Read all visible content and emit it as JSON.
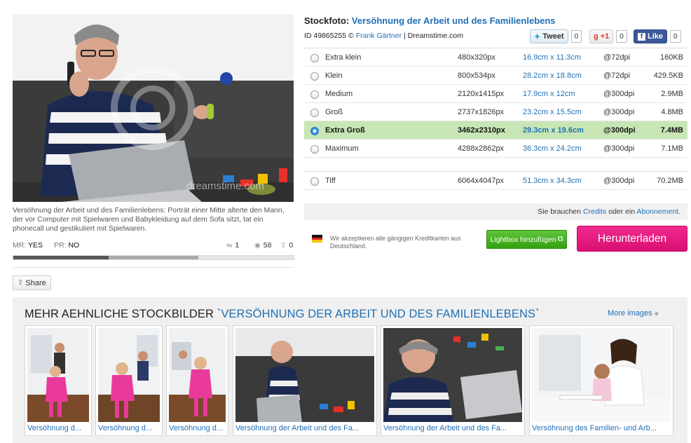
{
  "main_image": {
    "watermark": "dreamstime.com",
    "description": "Versöhnung der Arbeit und des Familienlebens: Porträt einer Mitte alterte den Mann, der vor Computer mit Spielwaren und Babykleidung auf dem Sofa sitzt, tat ein phonecall und gestikuliert mit Spielwaren.",
    "mr_label": "MR:",
    "mr_value": "YES",
    "pr_label": "PR:",
    "pr_value": "NO",
    "stats": {
      "downloads": "1",
      "views": "58",
      "likes": "0"
    },
    "rating_fraction_dark": 0.34,
    "rating_fraction_mid": 0.32,
    "share_label": "Share"
  },
  "header": {
    "prefix": "Stockfoto:",
    "title": "Versöhnung der Arbeit und des Familienlebens",
    "id_text": "ID 49865255 ©",
    "author": "Frank Gärtner",
    "agency": "| Dreamstime.com"
  },
  "social": {
    "tweet_label": "Tweet",
    "tweet_count": "0",
    "gplus_label": "+1",
    "gplus_count": "0",
    "like_label": "Like",
    "like_count": "0"
  },
  "sizes": [
    {
      "name": "Extra klein",
      "px": "480x320px",
      "cm": "16.9cm x 11.3cm",
      "dpi": "@72dpi",
      "filesize": "160KB",
      "selected": false
    },
    {
      "name": "Klein",
      "px": "800x534px",
      "cm": "28.2cm x 18.8cm",
      "dpi": "@72dpi",
      "filesize": "429.5KB",
      "selected": false
    },
    {
      "name": "Medium",
      "px": "2120x1415px",
      "cm": "17.9cm x 12cm",
      "dpi": "@300dpi",
      "filesize": "2.9MB",
      "selected": false
    },
    {
      "name": "Groß",
      "px": "2737x1826px",
      "cm": "23.2cm x 15.5cm",
      "dpi": "@300dpi",
      "filesize": "4.8MB",
      "selected": false
    },
    {
      "name": "Extra Groß",
      "px": "3462x2310px",
      "cm": "29.3cm x 19.6cm",
      "dpi": "@300dpi",
      "filesize": "7.4MB",
      "selected": true
    },
    {
      "name": "Maximum",
      "px": "4288x2862px",
      "cm": "36.3cm x 24.2cm",
      "dpi": "@300dpi",
      "filesize": "7.1MB",
      "selected": false
    },
    {
      "name": "Tiff",
      "px": "6064x4047px",
      "cm": "51.3cm x 34.3cm",
      "dpi": "@300dpi",
      "filesize": "70.2MB",
      "selected": false
    }
  ],
  "credits": {
    "text_before": "Sie brauchen",
    "credits_link": "Credits",
    "text_middle": "oder ein",
    "subscription_link": "Abonnement."
  },
  "purchase": {
    "payment_text": "Wir akzeptieren alle gängigen Kreditkarten aus Deutschland.",
    "lightbox_label": "Lightbox hinzufügen",
    "download_label": "Herunterladen"
  },
  "similar": {
    "heading_prefix": "MEHR AEHNLICHE STOCKBILDER `",
    "heading_highlight": "VERSÖHNUNG DER ARBEIT UND DES FAMILIENLEBENS",
    "heading_suffix": "`",
    "more_label": "More images",
    "thumbs": [
      {
        "caption": "Versöhnung d..."
      },
      {
        "caption": "Versöhnung d..."
      },
      {
        "caption": "Versöhnung d..."
      },
      {
        "caption": "Versöhnung der Arbeit und des Fa..."
      },
      {
        "caption": "Versöhnung der Arbeit und des Fa..."
      },
      {
        "caption": "Versöhnung des Familien- und Arb..."
      }
    ]
  }
}
